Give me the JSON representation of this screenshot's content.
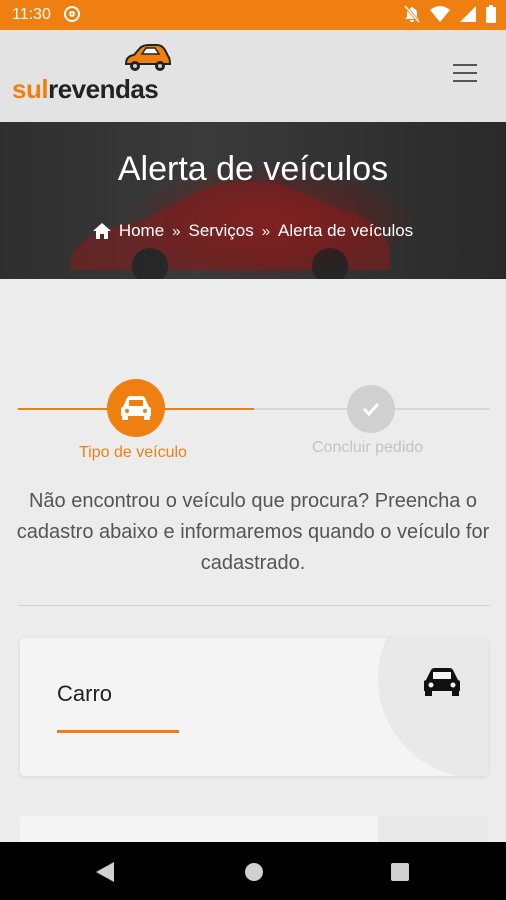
{
  "status": {
    "time": "11:30"
  },
  "brand": {
    "part1": "sul",
    "part2": "revendas"
  },
  "hero": {
    "title": "Alerta de veículos",
    "breadcrumb": [
      "Home",
      "Serviços",
      "Alerta de veículos"
    ]
  },
  "steps": [
    {
      "label": "Tipo de veículo",
      "active": true
    },
    {
      "label": "Concluir pedido",
      "active": false
    }
  ],
  "description": "Não encontrou o veículo que procura? Preencha o cadastro abaixo e informaremos quando o veículo for cadastrado.",
  "cards": [
    {
      "label": "Carro",
      "icon": "car-icon"
    }
  ],
  "colors": {
    "accent": "#f07f12",
    "hero_bg": "#2f2f2f",
    "page_bg": "#ececec"
  }
}
